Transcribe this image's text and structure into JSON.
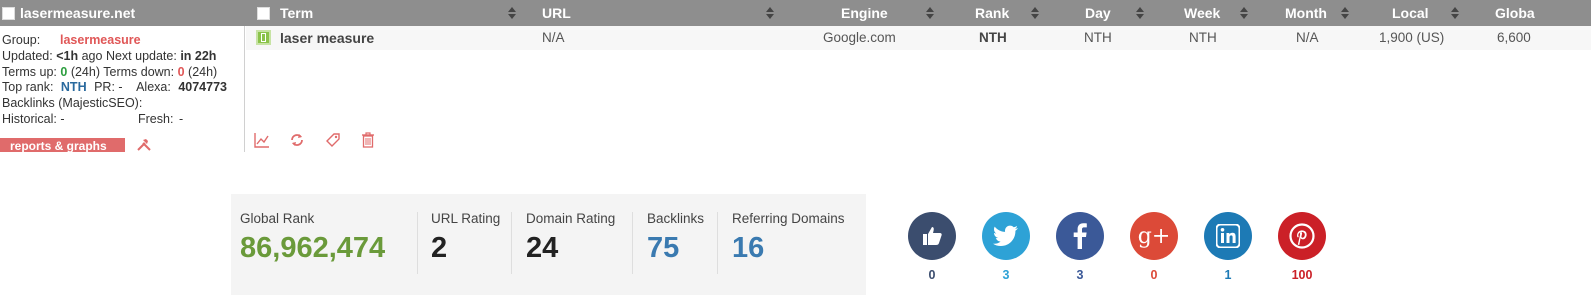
{
  "site": {
    "name": "lasermeasure.net"
  },
  "columns": [
    {
      "key": "term",
      "label": "Term"
    },
    {
      "key": "url",
      "label": "URL"
    },
    {
      "key": "engine",
      "label": "Engine"
    },
    {
      "key": "rank",
      "label": "Rank"
    },
    {
      "key": "day",
      "label": "Day"
    },
    {
      "key": "week",
      "label": "Week"
    },
    {
      "key": "month",
      "label": "Month"
    },
    {
      "key": "local",
      "label": "Local"
    },
    {
      "key": "global",
      "label": "Globa"
    }
  ],
  "info": {
    "group_label": "Group:",
    "group_value": "lasermeasure",
    "updated_label": "Updated:",
    "updated_value": "<1h",
    "updated_ago": "ago",
    "next_update_label": "Next update:",
    "next_update_value": "in 22h",
    "terms_up_label": "Terms up:",
    "terms_up_value": "0",
    "terms_up_period": "(24h)",
    "terms_down_label": "Terms down:",
    "terms_down_value": "0",
    "terms_down_period": "(24h)",
    "top_rank_label": "Top rank:",
    "top_rank_value": "NTH",
    "pr_label": "PR:",
    "pr_value": "-",
    "alexa_label": "Alexa:",
    "alexa_value": "4074773",
    "backlinks_label": "Backlinks (MajesticSEO):",
    "historical_label": "Historical:",
    "historical_value": "-",
    "fresh_label": "Fresh:",
    "fresh_value": "-",
    "reports_button": "reports & graphs"
  },
  "row": {
    "term": "laser measure",
    "url": "N/A",
    "engine": "Google.com",
    "rank": "NTH",
    "day": "NTH",
    "week": "NTH",
    "month": "N/A",
    "local": "1,900 (US)",
    "global": "6,600"
  },
  "stats": {
    "global_rank": {
      "label": "Global Rank",
      "value": "86,962,474",
      "color": "#6a9a3a"
    },
    "url_rating": {
      "label": "URL Rating",
      "value": "2",
      "color": "#222222"
    },
    "domain_rating": {
      "label": "Domain Rating",
      "value": "24",
      "color": "#222222"
    },
    "backlinks": {
      "label": "Backlinks",
      "value": "75",
      "color": "#3a7ab0"
    },
    "referring_domains": {
      "label": "Referring Domains",
      "value": "16",
      "color": "#3a7ab0"
    }
  },
  "social": [
    {
      "name": "like-icon",
      "count": "0",
      "color": "#3b4d6e",
      "count_color": "#3b4d6e"
    },
    {
      "name": "twitter-icon",
      "count": "3",
      "color": "#2ea2d6",
      "count_color": "#2ea2d6"
    },
    {
      "name": "facebook-icon",
      "count": "3",
      "color": "#3b5998",
      "count_color": "#3b5998"
    },
    {
      "name": "google-plus-icon",
      "count": "0",
      "color": "#dc4a38",
      "count_color": "#dc4a38"
    },
    {
      "name": "linkedin-icon",
      "count": "1",
      "color": "#1d7ab5",
      "count_color": "#1d7ab5"
    },
    {
      "name": "pinterest-icon",
      "count": "100",
      "color": "#cb2027",
      "count_color": "#cb2027"
    }
  ],
  "colors": {
    "header_bg": "#8e8e8e",
    "accent_red": "#e05757",
    "action_red": "#e06b6b"
  }
}
